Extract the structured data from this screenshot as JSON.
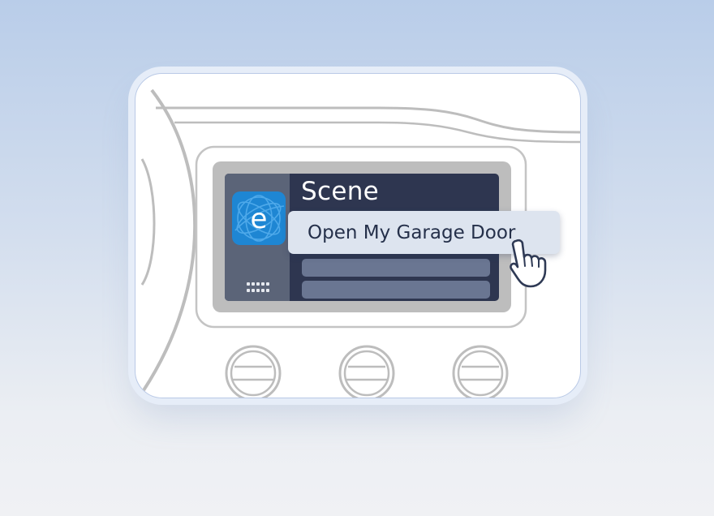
{
  "device": {
    "screen_title": "Scene",
    "app_icon": {
      "letter": "e",
      "name": "ewelink-app-icon",
      "color": "#1e86d3"
    },
    "apps_grid_icon": "apps-grid-icon",
    "menu_items": [
      "",
      ""
    ],
    "knobs": [
      "knob-left",
      "knob-center",
      "knob-right"
    ]
  },
  "popup": {
    "label": "Open My Garage Door"
  },
  "cursor": {
    "icon": "pointer-hand-icon"
  },
  "colors": {
    "screen_bg": "#2e3650",
    "screen_side": "#5b6478",
    "popup_bg": "#dde4ef",
    "popup_text": "#25304a"
  }
}
